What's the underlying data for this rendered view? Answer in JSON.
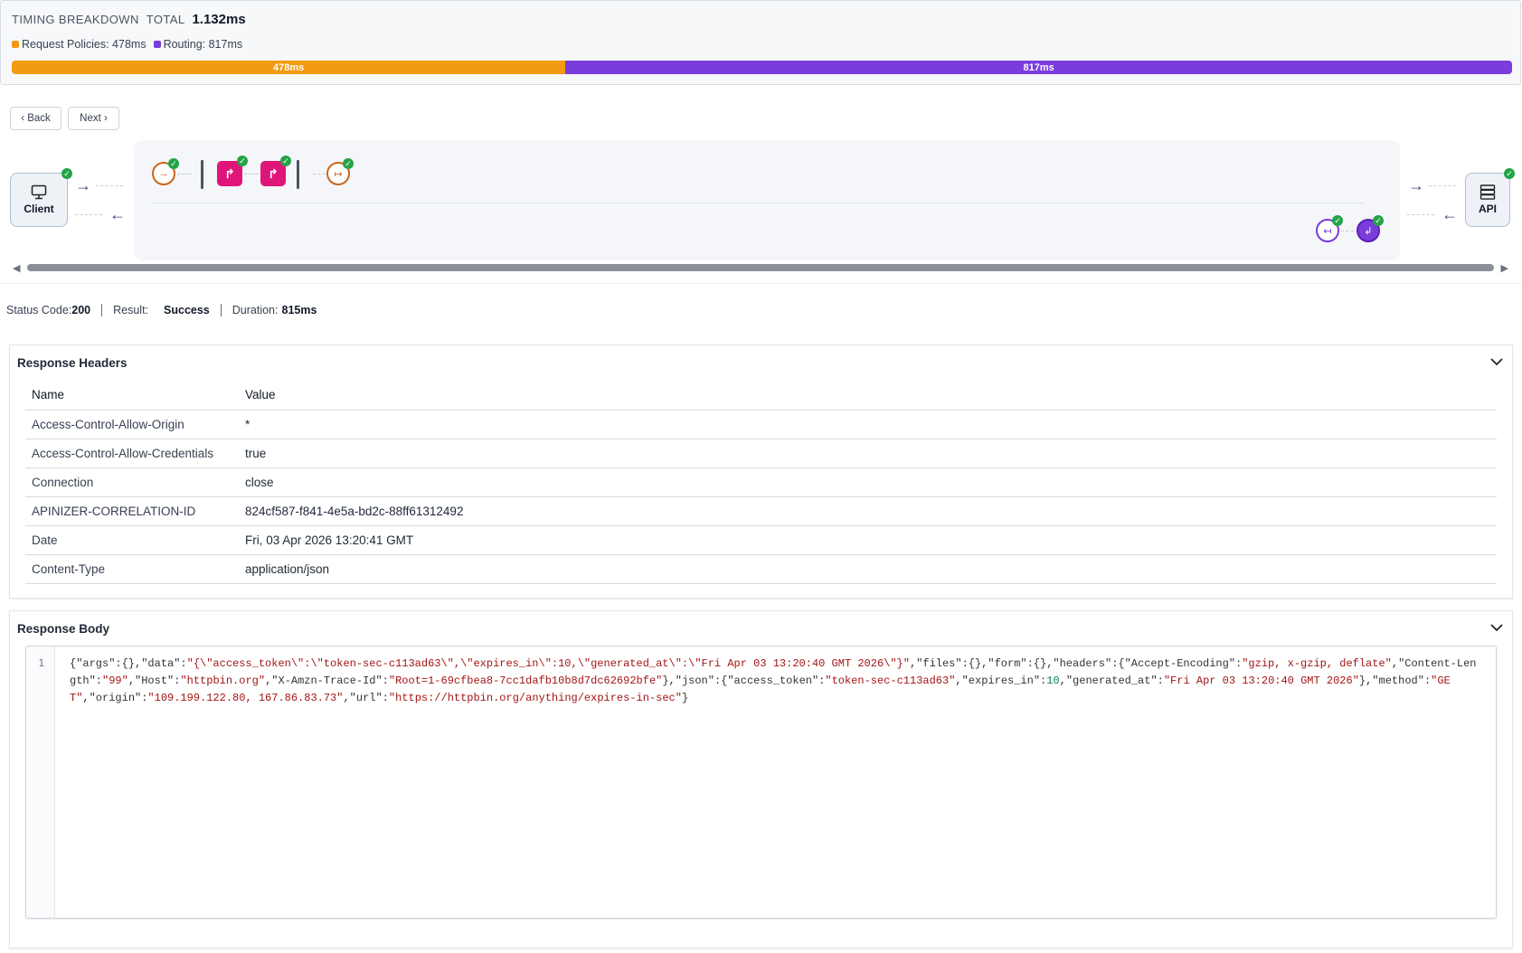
{
  "timing": {
    "title": "TIMING BREAKDOWN",
    "total_label": "TOTAL",
    "total": "1.132ms",
    "legend": [
      {
        "label": "Request Policies: 478ms",
        "color": "#f29a12"
      },
      {
        "label": "Routing: 817ms",
        "color": "#7a3cdb"
      }
    ],
    "segments": [
      {
        "label": "478ms",
        "value": 478,
        "color": "#f29a12"
      },
      {
        "label": "817ms",
        "value": 817,
        "color": "#7a3cdb"
      }
    ]
  },
  "nav": {
    "back": "‹ Back",
    "next": "Next ›"
  },
  "flow": {
    "client_label": "Client",
    "api_label": "API",
    "icons": [
      "monitor-icon",
      "server-icon",
      "policy-in-icon",
      "redirect-icon",
      "policy-out-icon",
      "check-icon"
    ]
  },
  "status": {
    "code_label": "Status Code:",
    "code": "200",
    "result_label": "Result:",
    "result": "Success",
    "duration_label": "Duration:",
    "duration": "815ms"
  },
  "response_headers": {
    "title": "Response Headers",
    "columns": [
      "Name",
      "Value"
    ],
    "rows": [
      [
        "Access-Control-Allow-Origin",
        "*"
      ],
      [
        "Access-Control-Allow-Credentials",
        "true"
      ],
      [
        "Connection",
        "close"
      ],
      [
        "APINIZER-CORRELATION-ID",
        "824cf587-f841-4e5a-bd2c-88ff61312492"
      ],
      [
        "Date",
        "Fri, 03 Apr 2026 13:20:41 GMT"
      ],
      [
        "Content-Type",
        "application/json"
      ]
    ]
  },
  "response_body": {
    "title": "Response Body",
    "line_number": "1",
    "content": "{\"args\":{},\"data\":\"{\\\"access_token\\\":\\\"token-sec-c113ad63\\\",\\\"expires_in\\\":10,\\\"generated_at\\\":\\\"Fri Apr 03 13:20:40 GMT 2026\\\"}\",\"files\":{},\"form\":{},\"headers\":{\"Accept-Encoding\":\"gzip, x-gzip, deflate\",\"Content-Length\":\"99\",\"Host\":\"httpbin.org\",\"X-Amzn-Trace-Id\":\"Root=1-69cfbea8-7cc1dafb10b8d7dc62692bfe\"},\"json\":{\"access_token\":\"token-sec-c113ad63\",\"expires_in\":10,\"generated_at\":\"Fri Apr 03 13:20:40 GMT 2026\"},\"method\":\"GET\",\"origin\":\"109.199.122.80, 167.86.83.73\",\"url\":\"https://httpbin.org/anything/expires-in-sec\"}"
  }
}
